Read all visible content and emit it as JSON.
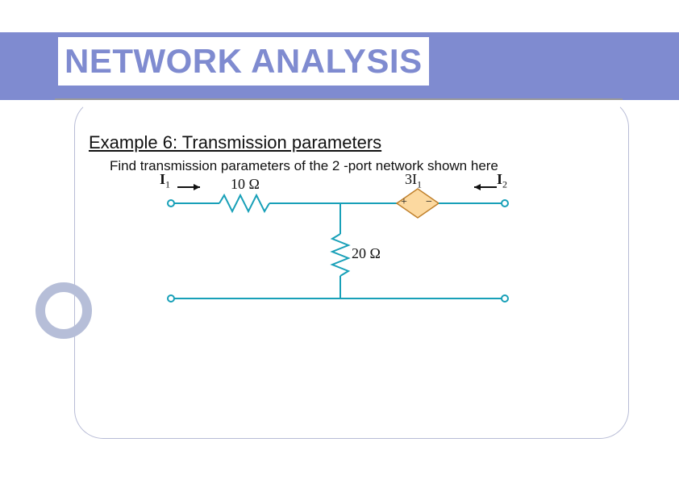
{
  "title": "NETWORK ANALYSIS",
  "subtitle": "Example 6: Transmission parameters",
  "body": "Find transmission parameters of the 2 -port network shown here",
  "circuit": {
    "I1_html": "<b>I</b><span class='sub'>1</span>",
    "I2_html": "<b>I</b><span class='sub'>2</span>",
    "dep_html": "3I<span class='sub'>1</span>",
    "R1": "10 Ω",
    "R2": "20 Ω",
    "plus": "+",
    "minus": "−"
  }
}
